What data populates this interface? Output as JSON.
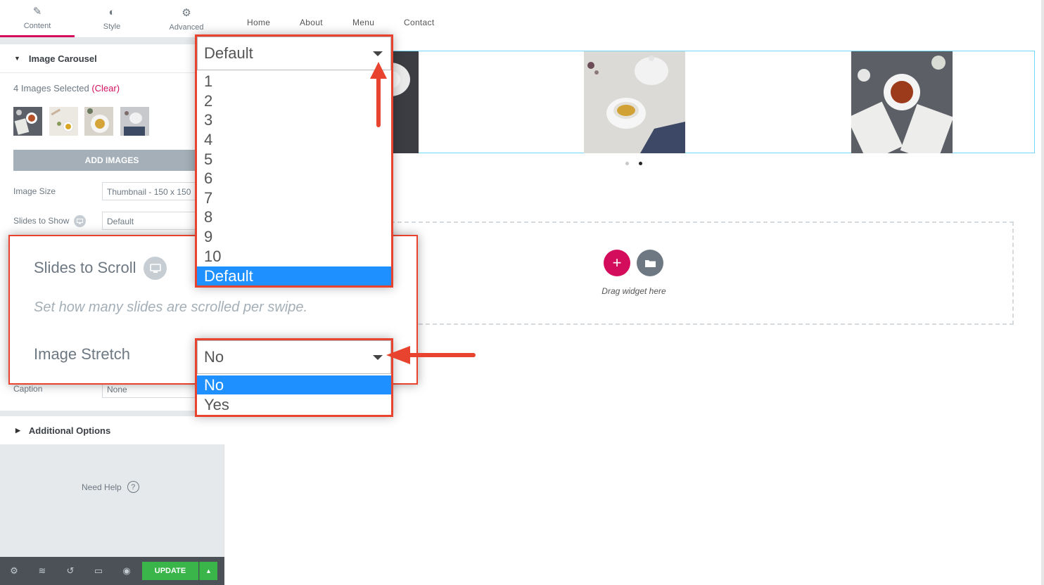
{
  "panel": {
    "tabs": [
      {
        "label": "Content",
        "icon": "pencil-icon"
      },
      {
        "label": "Style",
        "icon": "contrast-icon"
      },
      {
        "label": "Advanced",
        "icon": "gear-icon"
      }
    ],
    "section_title": "Image Carousel",
    "images_selected": "4 Images Selected",
    "clear_label": "(Clear)",
    "add_images_label": "ADD IMAGES",
    "image_size_label": "Image Size",
    "image_size_value": "Thumbnail - 150 x 150",
    "slides_to_show_label": "Slides to Show",
    "slides_to_show_value": "Default",
    "caption_label": "Caption",
    "caption_value": "None",
    "additional_options_title": "Additional Options",
    "need_help_label": "Need Help",
    "update_label": "UPDATE"
  },
  "nav": {
    "links": [
      "Home",
      "About",
      "Menu",
      "Contact"
    ]
  },
  "dropzone": {
    "drag_text": "Drag widget here"
  },
  "zoom": {
    "slides_to_scroll_label": "Slides to Scroll",
    "slides_to_scroll_desc": "Set how many slides are scrolled per swipe.",
    "image_stretch_label": "Image Stretch"
  },
  "dropdown_scroll": {
    "value": "Default",
    "options": [
      "1",
      "2",
      "3",
      "4",
      "5",
      "6",
      "7",
      "8",
      "9",
      "10",
      "Default"
    ],
    "selected": "Default"
  },
  "dropdown_stretch": {
    "value": "No",
    "options": [
      "No",
      "Yes"
    ],
    "selected": "No"
  },
  "colors": {
    "accent": "#d30c5c",
    "annotation_red": "#e8432e",
    "selection_blue": "#1e90ff",
    "update_green": "#39b54a"
  }
}
